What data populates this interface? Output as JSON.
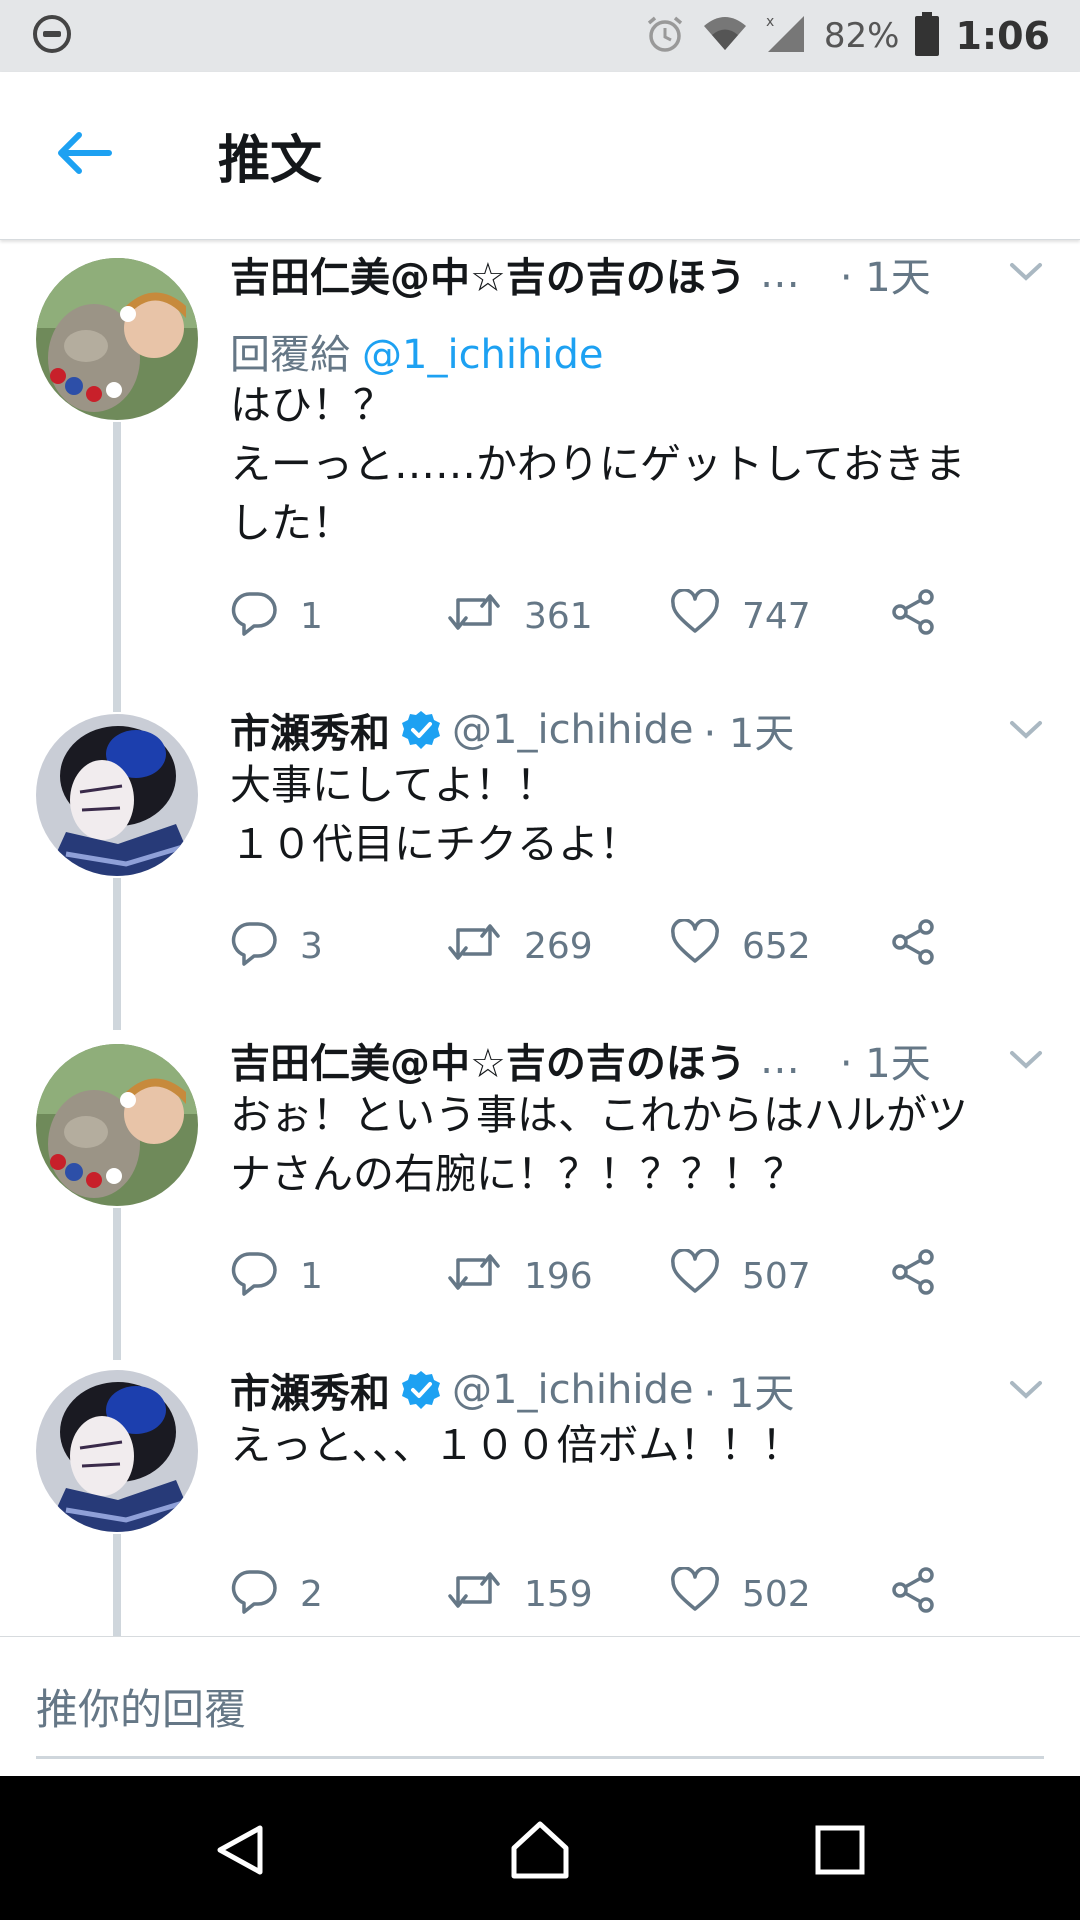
{
  "status_bar": {
    "battery_percent": "82%",
    "time": "1:06",
    "icons": [
      "circle-minus-icon",
      "alarm-icon",
      "wifi-icon",
      "signal-icon",
      "battery-icon"
    ]
  },
  "header": {
    "title": "推文",
    "back_icon": "arrow-left-icon"
  },
  "tweets": [
    {
      "name": "吉田仁美@中☆吉の吉のほう",
      "ellipsis": "…",
      "handle": "",
      "time": "· 1天",
      "verified": false,
      "reply_to_label": "回覆給",
      "reply_to_mention": "@1_ichihide",
      "text": [
        "はひ！？",
        "えーっと……かわりにゲットしておきま",
        "した！"
      ],
      "replies": "1",
      "retweets": "361",
      "likes": "747"
    },
    {
      "name": "市瀬秀和",
      "handle": "@1_ichihide",
      "time": "· 1天",
      "verified": true,
      "text": [
        "大事にしてよ！！",
        "１０代目にチクるよ！"
      ],
      "replies": "3",
      "retweets": "269",
      "likes": "652"
    },
    {
      "name": "吉田仁美@中☆吉の吉のほう",
      "ellipsis": "…",
      "handle": "",
      "time": "· 1天",
      "verified": false,
      "text": [
        "おぉ！という事は、これからはハルがツ",
        "ナさんの右腕に！？！？？！？"
      ],
      "replies": "1",
      "retweets": "196",
      "likes": "507"
    },
    {
      "name": "市瀬秀和",
      "handle": "@1_ichihide",
      "time": "· 1天",
      "verified": true,
      "text": [
        "えっと、、、１００倍ボム！！！"
      ],
      "replies": "2",
      "retweets": "159",
      "likes": "502"
    }
  ],
  "reply_box": {
    "placeholder": "推你的回覆"
  },
  "colors": {
    "accent": "#1da1f2",
    "secondary_text": "#657786",
    "thread_line": "#cfd6dc"
  }
}
